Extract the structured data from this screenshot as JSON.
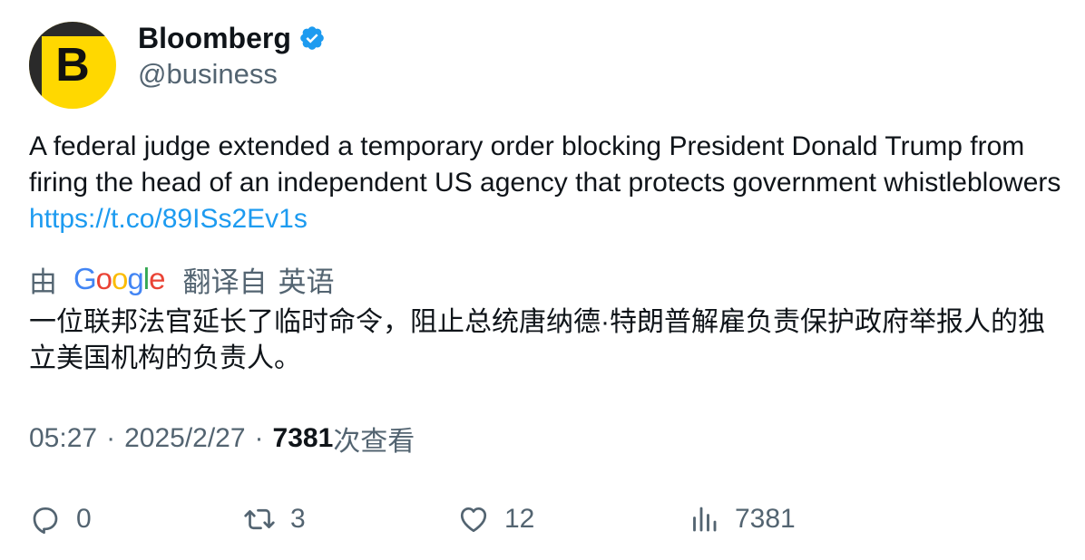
{
  "author": {
    "avatar_letter": "B",
    "display_name": "Bloomberg",
    "handle": "@business",
    "verified": true
  },
  "tweet": {
    "text": "A federal judge extended a temporary order blocking President Donald Trump from firing the head of an independent US agency that protects government whistleblowers ",
    "link": "https://t.co/89ISs2Ev1s"
  },
  "translation": {
    "prefix": "由",
    "provider": "Google",
    "suffix": "翻译自",
    "language": "英语",
    "text": "一位联邦法官延长了临时命令，阻止总统唐纳德·特朗普解雇负责保护政府举报人的独立美国机构的负责人。"
  },
  "meta": {
    "time": "05:27",
    "separator": "·",
    "date": "2025/2/27",
    "views": "7381",
    "views_label": "次查看"
  },
  "actions": {
    "replies": "0",
    "retweets": "3",
    "likes": "12",
    "views": "7381"
  },
  "colors": {
    "link": "#1d9bf0",
    "secondary_text": "#536471",
    "verified_badge": "#1d9bf0",
    "avatar_bg": "#ffd800"
  },
  "icons": {
    "verified": "verified-badge-icon",
    "reply": "reply-icon",
    "retweet": "retweet-icon",
    "like": "heart-icon",
    "views": "analytics-icon"
  }
}
